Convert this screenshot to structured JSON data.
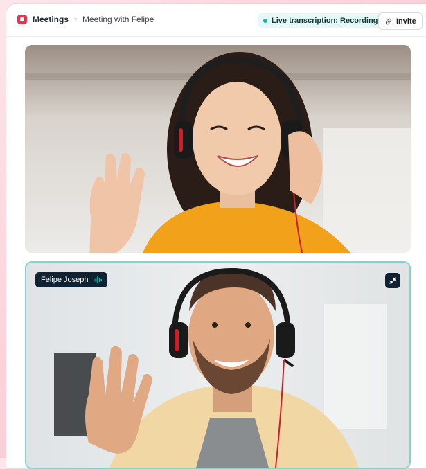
{
  "header": {
    "app_name": "Meetings",
    "breadcrumb_current": "Meeting with Felipe",
    "live_badge": "Live transcription: Recording",
    "invite_label": "Invite"
  },
  "participants": [
    {
      "name": "",
      "active_speaker": false
    },
    {
      "name": "Felipe Joseph",
      "active_speaker": true
    }
  ],
  "colors": {
    "brand": "#e8344e",
    "live_accent": "#1bb3a6",
    "active_border": "#7fd6cf",
    "tag_bg": "#0f2233"
  },
  "icons": {
    "app": "meetings-app-icon",
    "breadcrumb_separator": "chevron-right-icon",
    "invite": "link-icon",
    "speaking": "audio-wave-icon",
    "minimize": "minimize-arrows-icon"
  }
}
